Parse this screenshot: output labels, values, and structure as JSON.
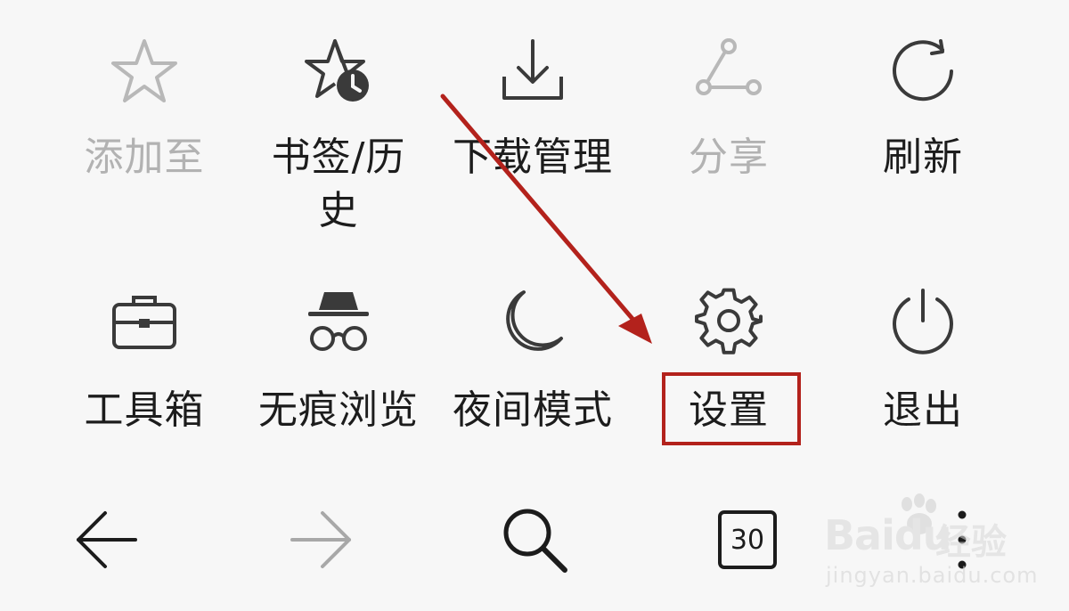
{
  "menu": {
    "row1": [
      {
        "label": "添加至",
        "icon": "star-icon",
        "disabled": true
      },
      {
        "label": "书签/历",
        "label2": "史",
        "icon": "bookmark-history-icon",
        "disabled": false
      },
      {
        "label": "下载管理",
        "icon": "download-icon",
        "disabled": false
      },
      {
        "label": "分享",
        "icon": "share-icon",
        "disabled": true
      },
      {
        "label": "刷新",
        "icon": "refresh-icon",
        "disabled": false
      }
    ],
    "row2": [
      {
        "label": "工具箱",
        "icon": "toolbox-icon"
      },
      {
        "label": "无痕浏览",
        "icon": "incognito-icon"
      },
      {
        "label": "夜间模式",
        "icon": "moon-icon"
      },
      {
        "label": "设置",
        "icon": "gear-icon"
      },
      {
        "label": "退出",
        "icon": "power-icon"
      }
    ]
  },
  "navbar": {
    "tab_count": "30",
    "icons": [
      "back-arrow-icon",
      "forward-arrow-icon",
      "search-icon",
      "tabs-icon",
      "more-icon"
    ]
  },
  "annotation": {
    "highlight_color": "#b3221c",
    "arrow_color": "#b3221c"
  },
  "watermark": {
    "brand": "Bai",
    "brand_suffix": "du",
    "brand_cn": "经验",
    "url": "jingyan.baidu.com"
  },
  "colors": {
    "background": "#f7f7f7",
    "icon_active": "#3a3a3a",
    "icon_disabled": "#b8b8b8",
    "text_active": "#1c1c1c",
    "text_disabled": "#b2b2b2"
  }
}
